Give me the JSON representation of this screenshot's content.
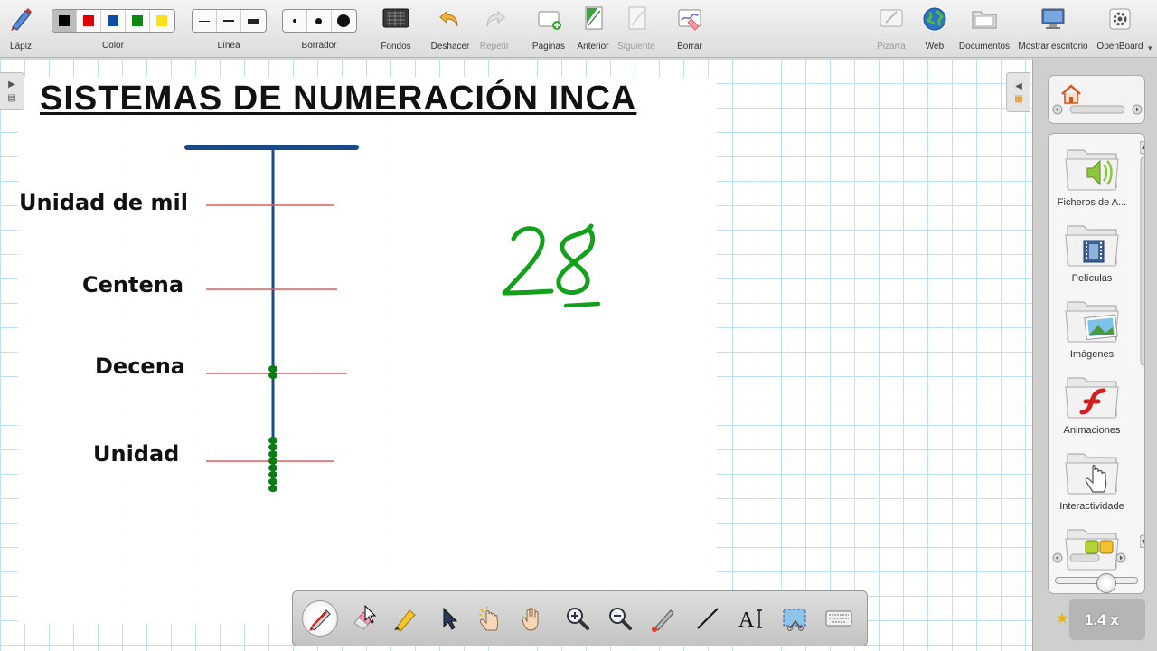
{
  "app": {
    "name": "OpenBoard"
  },
  "toolbar": {
    "pen_label": "Lápiz",
    "color_label": "Color",
    "line_label": "Línea",
    "eraser_label": "Borrador",
    "backgrounds_label": "Fondos",
    "undo_label": "Deshacer",
    "redo_label": "Repetir",
    "pages_label": "Páginas",
    "previous_label": "Anterior",
    "next_label": "Siguiente",
    "erase_label": "Borrar",
    "board_label": "Pizarra",
    "web_label": "Web",
    "documents_label": "Documentos",
    "desktop_label": "Mostrar escritorio",
    "openboard_label": "OpenBoard",
    "colors": [
      "#000000",
      "#e00000",
      "#0d4fa0",
      "#0a8a12",
      "#f5e31a"
    ],
    "active_color_index": 0
  },
  "board": {
    "title": "SISTEMAS DE NUMERACIÓN INCA",
    "rows": [
      {
        "label": "Unidad de mil",
        "knots": 0
      },
      {
        "label": "Centena",
        "knots": 0
      },
      {
        "label": "Decena",
        "knots": 2
      },
      {
        "label": "Unidad",
        "knots": 8
      }
    ],
    "handwritten_number": "28",
    "colors": {
      "main_cord": "#1a4a8a",
      "row_line": "#e35a5a",
      "knot": "#0b7d16",
      "ink": "#13a01b"
    }
  },
  "library": {
    "items": [
      {
        "label": "Ficheros de A...",
        "icon": "audio-folder-icon"
      },
      {
        "label": "Películas",
        "icon": "movie-folder-icon"
      },
      {
        "label": "Imágenes",
        "icon": "images-folder-icon"
      },
      {
        "label": "Animaciones",
        "icon": "flash-folder-icon"
      },
      {
        "label": "Interactividade",
        "icon": "interactive-folder-icon"
      }
    ],
    "zoom": "1.4 x"
  },
  "stylus": {
    "tools": [
      "pen-icon",
      "eraser-icon",
      "highlighter-icon",
      "selector-icon",
      "interact-icon",
      "hand-icon",
      "zoom-in-icon",
      "zoom-out-icon",
      "laser-icon",
      "line-icon",
      "text-icon",
      "capture-icon",
      "keyboard-icon"
    ],
    "active_tool": "pen-icon"
  }
}
